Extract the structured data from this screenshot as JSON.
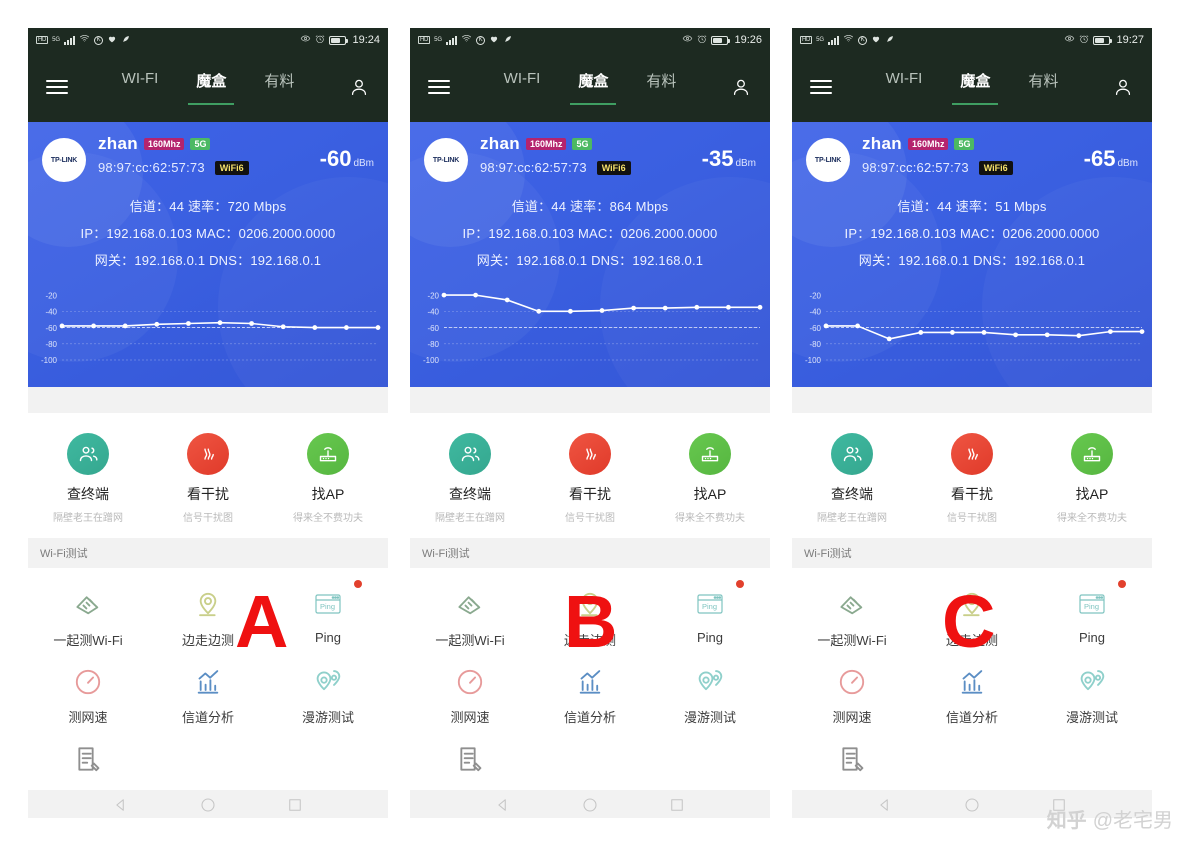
{
  "watermark": {
    "logo": "知乎",
    "handle": "@老宅男"
  },
  "annotations": [
    {
      "label": "A",
      "panel": 1
    },
    {
      "label": "B",
      "panel": 2
    },
    {
      "label": "C",
      "panel": 3
    }
  ],
  "colors": {
    "appbar": "#1d2a21",
    "card_blue": "#3a5fe0",
    "accent_green": "#3f9e62",
    "chip_mhz": "#b4246e",
    "chip_band": "#4cb963",
    "chip_wifi6_bg": "#111111",
    "chip_wifi6_text": "#f5e06a",
    "icon_teal": "#35a78f",
    "icon_red": "#e03a2a",
    "icon_green": "#56b640",
    "badge_red": "#e2402d",
    "annotation_red": "#ef1111"
  },
  "appbar": {
    "menu_icon": "hamburger-icon",
    "profile_icon": "person-icon",
    "tabs": [
      {
        "label": "WI-FI",
        "active": false
      },
      {
        "label": "魔盒",
        "active": true
      },
      {
        "label": "有料",
        "active": false
      }
    ]
  },
  "statusbar_icons": {
    "hd": "HD",
    "network": "5G",
    "signal_icon": "signal-bars-icon",
    "wifi_icon": "wifi-icon",
    "k_icon": "circle-k-icon",
    "heart_icon": "heart-icon",
    "extra_icon": "feather-icon",
    "eye_icon": "eye-icon",
    "alarm_icon": "alarm-clock-icon",
    "battery_icon": "battery-icon"
  },
  "shortcuts": [
    {
      "title": "查终端",
      "sub": "隔壁老王在蹭网",
      "icon": "people-icon",
      "color": "teal"
    },
    {
      "title": "看干扰",
      "sub": "信号干扰图",
      "icon": "heat-waves-icon",
      "color": "red"
    },
    {
      "title": "找AP",
      "sub": "得来全不费功夫",
      "icon": "router-icon",
      "color": "green"
    }
  ],
  "section": {
    "wifi_test": "Wi-Fi测试"
  },
  "tools_row1": [
    {
      "label": "一起测Wi-Fi",
      "icon": "hand-wifi-icon",
      "badge": false
    },
    {
      "label": "边走边测",
      "icon": "location-pin-icon",
      "badge": false
    },
    {
      "label": "Ping",
      "icon": "ping-window-icon",
      "badge": true
    }
  ],
  "tools_row2": [
    {
      "label": "测网速",
      "icon": "speedometer-icon",
      "badge": false
    },
    {
      "label": "信道分析",
      "icon": "bar-chart-icon",
      "badge": false
    },
    {
      "label": "漫游测试",
      "icon": "roaming-pins-icon",
      "badge": false
    }
  ],
  "tools_row3": [
    {
      "label": "",
      "icon": "report-edit-icon",
      "badge": false
    }
  ],
  "androidnav": {
    "back": "back-triangle-icon",
    "home": "home-circle-icon",
    "recents": "recents-square-icon"
  },
  "panels": [
    {
      "id": "panel-a",
      "time": "19:24",
      "ssid": "zhan",
      "chip_mhz": "160Mhz",
      "chip_band": "5G",
      "bssid": "98:97:cc:62:57:73",
      "chip_wifi6": "WiFi6",
      "rssi": "-60",
      "rssi_unit": "dBm",
      "line_channel": "信道：44  速率：720 Mbps",
      "line_ip": "IP：192.168.0.103  MAC：0206.2000.0000",
      "line_gateway": "网关：192.168.0.1  DNS：192.168.0.1",
      "logo_text": "TP-LINK"
    },
    {
      "id": "panel-b",
      "time": "19:26",
      "ssid": "zhan",
      "chip_mhz": "160Mhz",
      "chip_band": "5G",
      "bssid": "98:97:cc:62:57:73",
      "chip_wifi6": "WiFi6",
      "rssi": "-35",
      "rssi_unit": "dBm",
      "line_channel": "信道：44  速率：864 Mbps",
      "line_ip": "IP：192.168.0.103  MAC：0206.2000.0000",
      "line_gateway": "网关：192.168.0.1  DNS：192.168.0.1",
      "logo_text": "TP-LINK"
    },
    {
      "id": "panel-c",
      "time": "19:27",
      "ssid": "zhan",
      "chip_mhz": "160Mhz",
      "chip_band": "5G",
      "bssid": "98:97:cc:62:57:73",
      "chip_wifi6": "WiFi6",
      "rssi": "-65",
      "rssi_unit": "dBm",
      "line_channel": "信道：44  速率：51 Mbps",
      "line_ip": "IP：192.168.0.103  MAC：0206.2000.0000",
      "line_gateway": "网关：192.168.0.1  DNS：192.168.0.1",
      "logo_text": "TP-LINK"
    }
  ],
  "chart_data": [
    {
      "type": "line",
      "title": "",
      "panel": "panel-a",
      "ylabel": "dBm",
      "ylim": [
        -100,
        -10
      ],
      "yticks": [
        -20,
        -40,
        -60,
        -80,
        -100
      ],
      "grid": true,
      "threshold": -60,
      "x": [
        0,
        1,
        2,
        3,
        4,
        5,
        6,
        7,
        8,
        9,
        10
      ],
      "values": [
        -58,
        -58,
        -58,
        -56,
        -55,
        -54,
        -55,
        -59,
        -60,
        -60,
        -60
      ]
    },
    {
      "type": "line",
      "title": "",
      "panel": "panel-b",
      "ylabel": "dBm",
      "ylim": [
        -100,
        -10
      ],
      "yticks": [
        -20,
        -40,
        -60,
        -80,
        -100
      ],
      "grid": true,
      "threshold": -60,
      "x": [
        0,
        1,
        2,
        3,
        4,
        5,
        6,
        7,
        8,
        9,
        10
      ],
      "values": [
        -20,
        -20,
        -26,
        -40,
        -40,
        -39,
        -36,
        -36,
        -35,
        -35,
        -35
      ]
    },
    {
      "type": "line",
      "title": "",
      "panel": "panel-c",
      "ylabel": "dBm",
      "ylim": [
        -100,
        -10
      ],
      "yticks": [
        -20,
        -40,
        -60,
        -80,
        -100
      ],
      "grid": true,
      "threshold": -60,
      "x": [
        0,
        1,
        2,
        3,
        4,
        5,
        6,
        7,
        8,
        9,
        10
      ],
      "values": [
        -58,
        -58,
        -74,
        -66,
        -66,
        -66,
        -69,
        -69,
        -70,
        -65,
        -65
      ]
    }
  ]
}
